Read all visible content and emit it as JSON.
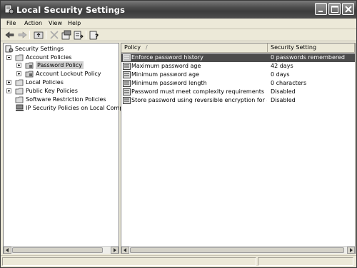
{
  "window": {
    "title": "Local Security Settings",
    "icon": "security-settings-icon"
  },
  "title_buttons": [
    "minimize",
    "maximize",
    "close"
  ],
  "menu": [
    "File",
    "Action",
    "View",
    "Help"
  ],
  "toolbar": [
    "back-arrow-icon",
    "forward-arrow-icon",
    "up-folder-icon",
    "delete-icon",
    "properties-icon",
    "export-list-icon",
    "help-icon"
  ],
  "tree": {
    "root": "Security Settings",
    "items": [
      {
        "label": "Account Policies",
        "expanded": true
      },
      {
        "label": "Password Policy",
        "expanded": false,
        "selected": true
      },
      {
        "label": "Account Lockout Policy",
        "expanded": false
      },
      {
        "label": "Local Policies",
        "expanded": false
      },
      {
        "label": "Public Key Policies",
        "expanded": false
      },
      {
        "label": "Software Restriction Policies"
      },
      {
        "label": "IP Security Policies on Local Computer"
      }
    ]
  },
  "list": {
    "columns": {
      "policy": "Policy",
      "sort_indicator": "/",
      "setting": "Security Setting"
    },
    "rows": [
      {
        "policy": "Enforce password history",
        "setting": "0 passwords remembered",
        "selected": true
      },
      {
        "policy": "Maximum password age",
        "setting": "42 days"
      },
      {
        "policy": "Minimum password age",
        "setting": "0 days"
      },
      {
        "policy": "Minimum password length",
        "setting": "0 characters"
      },
      {
        "policy": "Password must meet complexity requirements",
        "setting": "Disabled"
      },
      {
        "policy": "Store password using reversible encryption for all u...",
        "setting": "Disabled"
      }
    ]
  }
}
